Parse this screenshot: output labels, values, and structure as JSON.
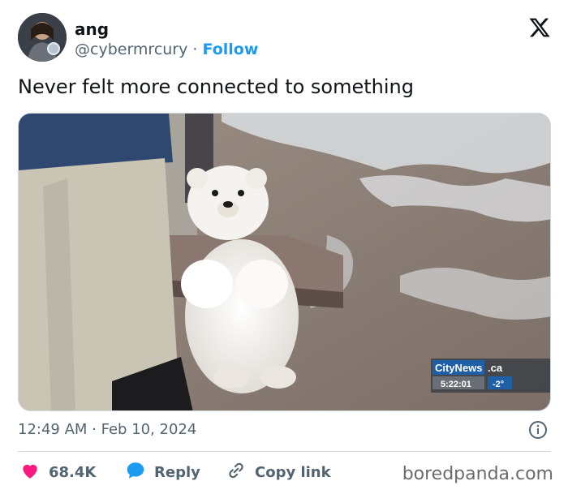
{
  "author": {
    "name": "ang",
    "handle": "@cybermrcury",
    "separator": "·",
    "follow_label": "Follow"
  },
  "tweet": {
    "text": "Never felt more connected to something",
    "timestamp": "12:49 AM · Feb 10, 2024"
  },
  "media": {
    "overlay_brand": "CityNews",
    "overlay_domain": ".ca",
    "overlay_time": "5:22:01",
    "overlay_temp": "-2°"
  },
  "actions": {
    "likes": "68.4K",
    "reply_label": "Reply",
    "copy_link_label": "Copy link"
  },
  "watermark": "boredpanda.com",
  "colors": {
    "accent": "#1d9bf0",
    "like": "#f91880",
    "text": "#0f1419",
    "muted": "#536471"
  },
  "icons": [
    "x-logo-icon",
    "info-icon",
    "heart-icon",
    "reply-bubble-icon",
    "link-icon"
  ]
}
